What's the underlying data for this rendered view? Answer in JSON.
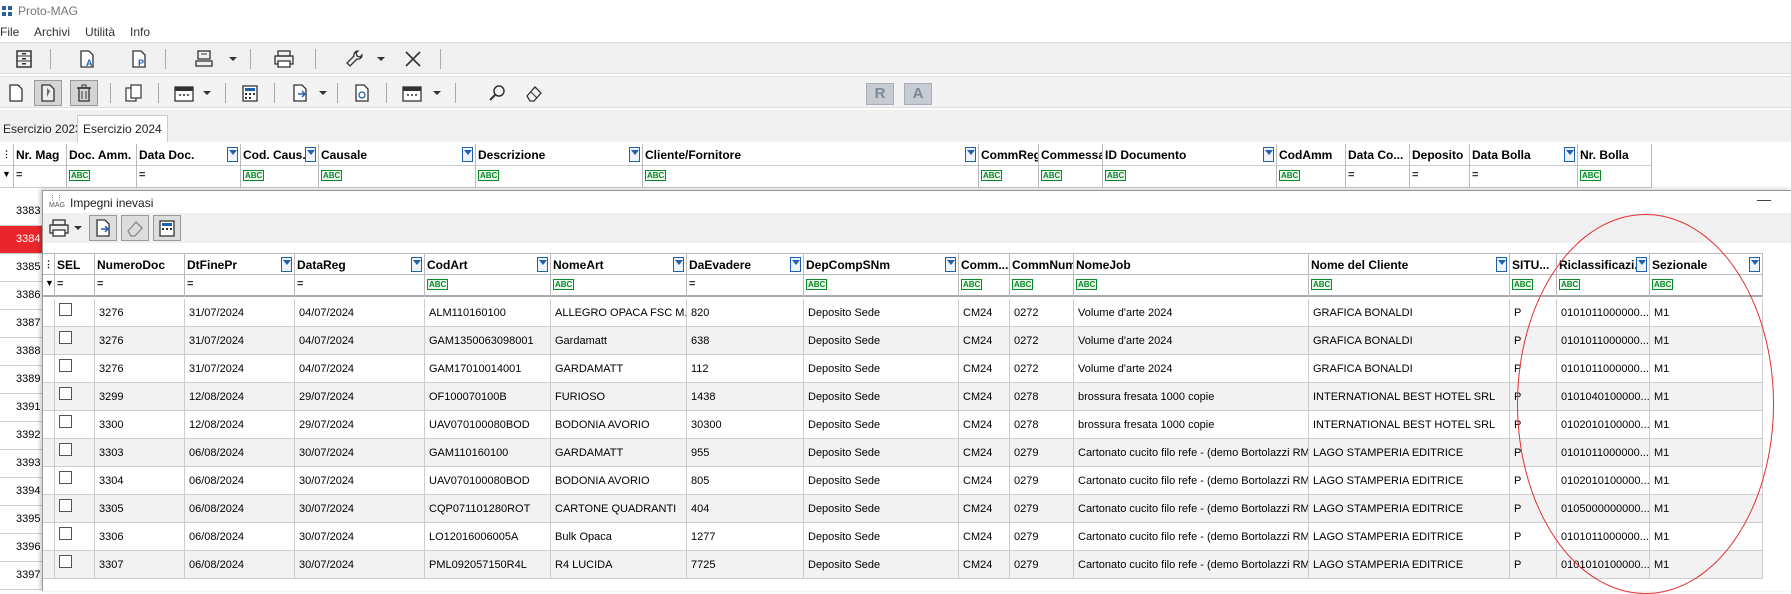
{
  "app": {
    "title": "Proto-MAG"
  },
  "menu": [
    "File",
    "Archivi",
    "Utilità",
    "Info"
  ],
  "toolbar2_letters": {
    "r": "R",
    "a": "A"
  },
  "tabs": [
    "Esercizio 2023",
    "Esercizio 2024"
  ],
  "main_grid": {
    "columns": [
      "Nr. Mag",
      "Doc. Amm.",
      "Data Doc.",
      "Cod. Caus.",
      "Causale",
      "Descrizione",
      "Cliente/Fornitore",
      "CommReg",
      "Commessa",
      "ID Documento",
      "CodAmm",
      "Data Co...",
      "Deposito",
      "Data Bolla",
      "Nr. Bolla"
    ],
    "row_numbers": [
      "3383",
      "3384",
      "3385",
      "3386",
      "3387",
      "3388",
      "3389",
      "3391",
      "3392",
      "3393",
      "3394",
      "3395",
      "3396",
      "3397"
    ],
    "selected_row": "3384"
  },
  "filter_symbols": {
    "eq": "=",
    "abc": "ABC"
  },
  "popup": {
    "title": "Impegni inevasi",
    "minimize": "—",
    "columns": [
      "SEL",
      "NumeroDoc",
      "DtFinePr",
      "DataReg",
      "CodArt",
      "NomeArt",
      "DaEvadere",
      "DepCompSNm",
      "Comm...",
      "CommNum",
      "NomeJob",
      "Nome del Cliente",
      "SITU...",
      "Riclassificazi...",
      "Sezionale"
    ],
    "rows": [
      [
        "",
        "3276",
        "31/07/2024",
        "04/07/2024",
        "ALM110160100",
        "ALLEGRO OPACA FSC M...",
        "820",
        "Deposito Sede",
        "CM24",
        "0272",
        "Volume d'arte 2024",
        "GRAFICA BONALDI",
        "P",
        "0101011000000...",
        "M1"
      ],
      [
        "",
        "3276",
        "31/07/2024",
        "04/07/2024",
        "GAM1350063098001",
        "Gardamatt",
        "638",
        "Deposito Sede",
        "CM24",
        "0272",
        "Volume d'arte 2024",
        "GRAFICA BONALDI",
        "P",
        "0101011000000...",
        "M1"
      ],
      [
        "",
        "3276",
        "31/07/2024",
        "04/07/2024",
        "GAM17010014001",
        "GARDAMATT",
        "112",
        "Deposito Sede",
        "CM24",
        "0272",
        "Volume d'arte 2024",
        "GRAFICA BONALDI",
        "P",
        "0101011000000...",
        "M1"
      ],
      [
        "",
        "3299",
        "12/08/2024",
        "29/07/2024",
        "OF100070100B",
        "FURIOSO",
        "1438",
        "Deposito Sede",
        "CM24",
        "0278",
        "brossura fresata 1000 copie",
        "INTERNATIONAL BEST HOTEL SRL",
        "P",
        "0101040100000...",
        "M1"
      ],
      [
        "",
        "3300",
        "12/08/2024",
        "29/07/2024",
        "UAV070100080BOD",
        "BODONIA AVORIO",
        "30300",
        "Deposito Sede",
        "CM24",
        "0278",
        "brossura fresata 1000 copie",
        "INTERNATIONAL BEST HOTEL SRL",
        "P",
        "0102010100000...",
        "M1"
      ],
      [
        "",
        "3303",
        "06/08/2024",
        "30/07/2024",
        "GAM110160100",
        "GARDAMATT",
        "955",
        "Deposito Sede",
        "CM24",
        "0279",
        "Cartonato cucito filo refe - (demo Bortolazzi RM)",
        "LAGO STAMPERIA EDITRICE",
        "P",
        "0101011000000...",
        "M1"
      ],
      [
        "",
        "3304",
        "06/08/2024",
        "30/07/2024",
        "UAV070100080BOD",
        "BODONIA AVORIO",
        "805",
        "Deposito Sede",
        "CM24",
        "0279",
        "Cartonato cucito filo refe - (demo Bortolazzi RM)",
        "LAGO STAMPERIA EDITRICE",
        "P",
        "0102010100000...",
        "M1"
      ],
      [
        "",
        "3305",
        "06/08/2024",
        "30/07/2024",
        "CQP071101280ROT",
        "CARTONE QUADRANTI",
        "404",
        "Deposito Sede",
        "CM24",
        "0279",
        "Cartonato cucito filo refe - (demo Bortolazzi RM)",
        "LAGO STAMPERIA EDITRICE",
        "P",
        "0105000000000...",
        "M1"
      ],
      [
        "",
        "3306",
        "06/08/2024",
        "30/07/2024",
        "LO12016006005A",
        "Bulk Opaca",
        "1277",
        "Deposito Sede",
        "CM24",
        "0279",
        "Cartonato cucito filo refe - (demo Bortolazzi RM)",
        "LAGO STAMPERIA EDITRICE",
        "P",
        "0101011000000...",
        "M1"
      ],
      [
        "",
        "3307",
        "06/08/2024",
        "30/07/2024",
        "PML092057150R4L",
        "R4 LUCIDA",
        "7725",
        "Deposito Sede",
        "CM24",
        "0279",
        "Cartonato cucito filo refe - (demo Bortolazzi RM)",
        "LAGO STAMPERIA EDITRICE",
        "P",
        "0101010100000...",
        "M1"
      ]
    ]
  },
  "colors": {
    "selected_row": "#e8262c",
    "annotation": "#e03030",
    "filter_icon": "#2060b0"
  }
}
